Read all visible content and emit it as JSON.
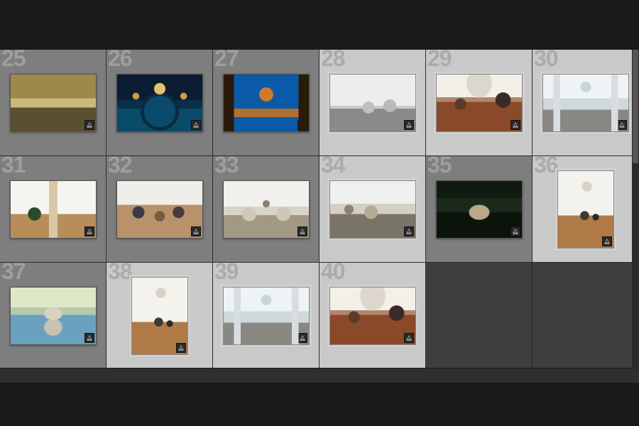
{
  "grid": {
    "columns": 6,
    "rows": 3,
    "cells": [
      {
        "index": 25,
        "selected": false,
        "orientation": "landscape",
        "art": "art25",
        "has_adjust_badge": true
      },
      {
        "index": 26,
        "selected": false,
        "orientation": "landscape",
        "art": "art26",
        "has_adjust_badge": true
      },
      {
        "index": 27,
        "selected": false,
        "orientation": "landscape",
        "art": "art27",
        "has_adjust_badge": true
      },
      {
        "index": 28,
        "selected": true,
        "orientation": "landscape",
        "art": "art28",
        "has_adjust_badge": true
      },
      {
        "index": 29,
        "selected": true,
        "orientation": "landscape",
        "art": "art29",
        "has_adjust_badge": true
      },
      {
        "index": 30,
        "selected": true,
        "orientation": "landscape",
        "art": "art30",
        "has_adjust_badge": true
      },
      {
        "index": 31,
        "selected": false,
        "orientation": "landscape",
        "art": "art31",
        "has_adjust_badge": true
      },
      {
        "index": 32,
        "selected": false,
        "orientation": "landscape",
        "art": "art32",
        "has_adjust_badge": true
      },
      {
        "index": 33,
        "selected": false,
        "orientation": "landscape",
        "art": "art33",
        "has_adjust_badge": true
      },
      {
        "index": 34,
        "selected": true,
        "orientation": "landscape",
        "art": "art34",
        "has_adjust_badge": true
      },
      {
        "index": 35,
        "selected": false,
        "orientation": "landscape",
        "art": "art35",
        "has_adjust_badge": true
      },
      {
        "index": 36,
        "selected": true,
        "orientation": "portrait",
        "art": "art36",
        "has_adjust_badge": true
      },
      {
        "index": 37,
        "selected": false,
        "orientation": "landscape",
        "art": "art37",
        "has_adjust_badge": true
      },
      {
        "index": 38,
        "selected": true,
        "orientation": "portrait",
        "art": "art38",
        "has_adjust_badge": true
      },
      {
        "index": 39,
        "selected": true,
        "orientation": "landscape",
        "art": "art39",
        "has_adjust_badge": true
      },
      {
        "index": 40,
        "selected": true,
        "orientation": "landscape",
        "art": "art40",
        "has_adjust_badge": true
      },
      {
        "empty": true
      },
      {
        "empty": true
      }
    ]
  },
  "badge_icon": "develop-adjust-icon"
}
